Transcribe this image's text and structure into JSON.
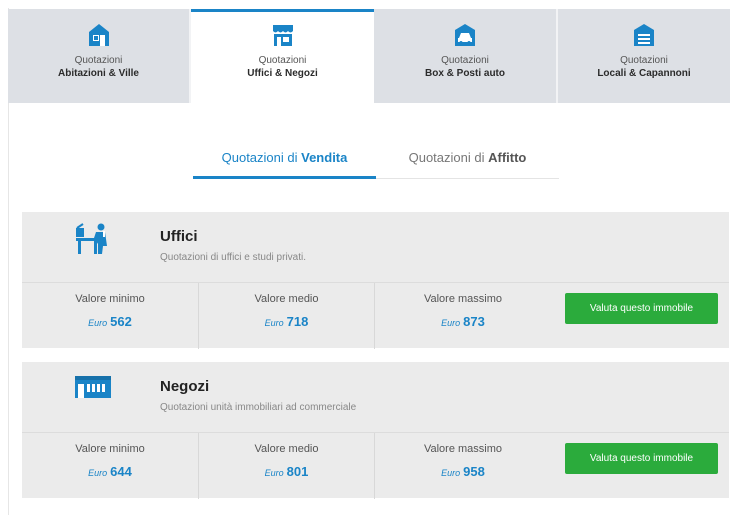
{
  "category_tabs": [
    {
      "small": "Quotazioni",
      "big": "Abitazioni & Ville",
      "icon": "house-icon"
    },
    {
      "small": "Quotazioni",
      "big": "Uffici & Negozi",
      "icon": "shop-icon"
    },
    {
      "small": "Quotazioni",
      "big": "Box & Posti auto",
      "icon": "car-garage-icon"
    },
    {
      "small": "Quotazioni",
      "big": "Locali & Capannoni",
      "icon": "warehouse-icon"
    }
  ],
  "active_category": 1,
  "sub_tabs": [
    {
      "prefix": "Quotazioni di ",
      "bold": "Vendita"
    },
    {
      "prefix": "Quotazioni di ",
      "bold": "Affitto"
    }
  ],
  "active_sub_tab": 0,
  "colors": {
    "accent": "#1a84c7",
    "button": "#2bab3c",
    "tab_bg": "#dde0e5",
    "card_bg": "#ebebeb"
  },
  "cards": [
    {
      "title": "Uffici",
      "description": "Quotazioni di uffici e studi privati.",
      "icon": "office-desk-icon",
      "min_label": "Valore minimo",
      "min_currency": "Euro",
      "min_value": "562",
      "avg_label": "Valore medio",
      "avg_currency": "Euro",
      "avg_value": "718",
      "max_label": "Valore massimo",
      "max_currency": "Euro",
      "max_value": "873",
      "button_label": "Valuta questo immobile"
    },
    {
      "title": "Negozi",
      "description": "Quotazioni unità immobiliari ad commerciale",
      "icon": "storefront-icon",
      "min_label": "Valore minimo",
      "min_currency": "Euro",
      "min_value": "644",
      "avg_label": "Valore medio",
      "avg_currency": "Euro",
      "avg_value": "801",
      "max_label": "Valore massimo",
      "max_currency": "Euro",
      "max_value": "958",
      "button_label": "Valuta questo immobile"
    }
  ]
}
